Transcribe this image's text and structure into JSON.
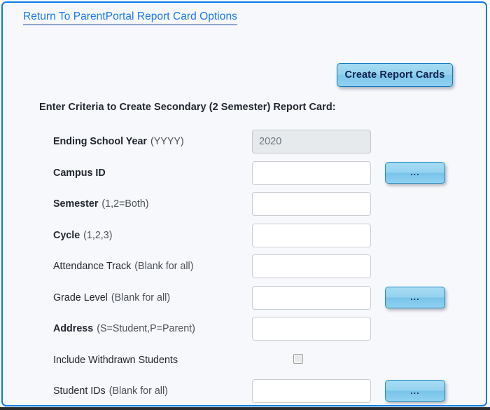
{
  "frame": {
    "border_color": "#0d7ae5",
    "background_color": "#f7f8fc"
  },
  "header": {
    "return_link_label": "Return To ParentPortal Report Card Options",
    "link_color": "#1a7aed"
  },
  "toolbar": {
    "create_button_label": "Create Report Cards",
    "create_button_color": "#93d2ef"
  },
  "form": {
    "heading": "Enter Criteria to Create Secondary (2 Semester) Report Card:",
    "lookup_button_label": "...",
    "rows": [
      {
        "name": "ending-school-year",
        "label": "Ending School Year",
        "hint": "(YYYY)",
        "bold": true,
        "control": "text",
        "value": "2020",
        "readonly": true,
        "lookup": false
      },
      {
        "name": "campus-id",
        "label": "Campus ID",
        "hint": "",
        "bold": true,
        "control": "text",
        "value": "",
        "readonly": false,
        "lookup": true
      },
      {
        "name": "semester",
        "label": "Semester",
        "hint": "(1,2=Both)",
        "bold": true,
        "control": "text",
        "value": "",
        "readonly": false,
        "lookup": false
      },
      {
        "name": "cycle",
        "label": "Cycle",
        "hint": "(1,2,3)",
        "bold": true,
        "control": "text",
        "value": "",
        "readonly": false,
        "lookup": false
      },
      {
        "name": "attendance-track",
        "label": "Attendance Track",
        "hint": "(Blank for all)",
        "bold": false,
        "control": "text",
        "value": "",
        "readonly": false,
        "lookup": false
      },
      {
        "name": "grade-level",
        "label": "Grade Level",
        "hint": "(Blank for all)",
        "bold": false,
        "control": "text",
        "value": "",
        "readonly": false,
        "lookup": true
      },
      {
        "name": "address",
        "label": "Address",
        "hint": "(S=Student,P=Parent)",
        "bold": true,
        "control": "text",
        "value": "",
        "readonly": false,
        "lookup": false
      },
      {
        "name": "include-withdrawn-students",
        "label": "Include Withdrawn Students",
        "hint": "",
        "bold": false,
        "control": "checkbox",
        "checked": false,
        "lookup": false
      },
      {
        "name": "student-ids",
        "label": "Student IDs",
        "hint": "(Blank for all)",
        "bold": false,
        "control": "text",
        "value": "",
        "readonly": false,
        "lookup": true
      }
    ]
  }
}
